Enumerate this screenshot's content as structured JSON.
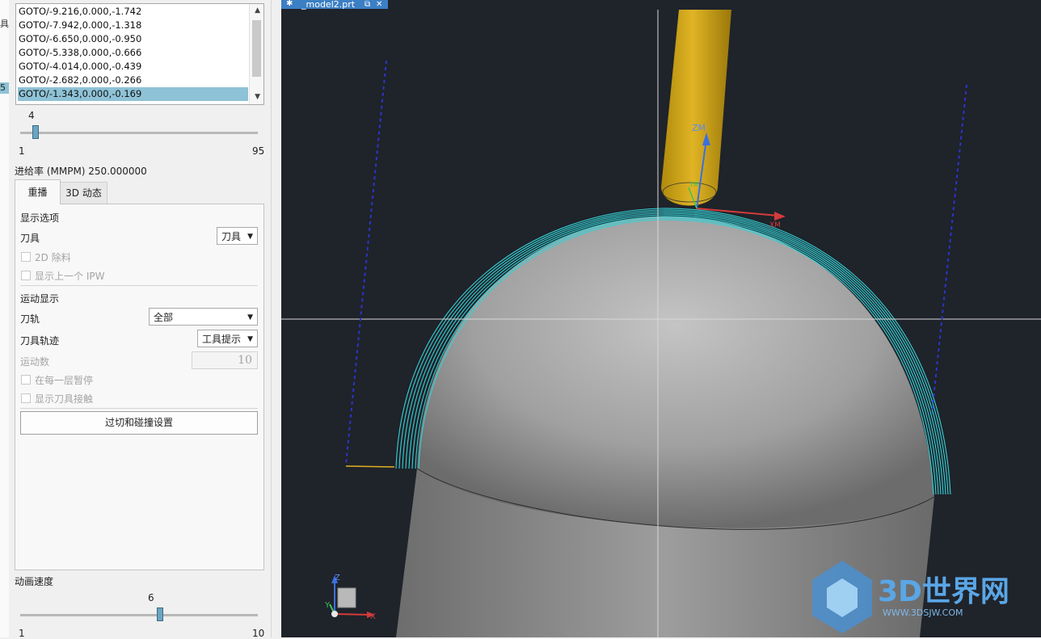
{
  "side_strip": {
    "char_top": "具",
    "char_sel": "5"
  },
  "toolpath_list": {
    "items": [
      "GOTO/-9.216,0.000,-1.742",
      "GOTO/-7.942,0.000,-1.318",
      "GOTO/-6.650,0.000,-0.950",
      "GOTO/-5.338,0.000,-0.666",
      "GOTO/-4.014,0.000,-0.439",
      "GOTO/-2.682,0.000,-0.266",
      "GOTO/-1.343,0.000,-0.169"
    ],
    "selected_index": 6
  },
  "position_slider": {
    "value": "4",
    "min": "1",
    "max": "95",
    "fraction": 0.032
  },
  "feed_rate": "进给率 (MMPM) 250.000000",
  "tabs": {
    "replay": "重播",
    "dynamic3d": "3D 动态"
  },
  "display_options": {
    "heading": "显示选项",
    "tool_label": "刀具",
    "tool_value": "刀具",
    "ipw2d": "2D 除料",
    "show_prev_ipw": "显示上一个 IPW"
  },
  "motion_display": {
    "heading": "运动显示",
    "toolpath_label": "刀轨",
    "toolpath_value": "全部",
    "tool_trace_label": "刀具轨迹",
    "tool_trace_value": "工具提示",
    "motion_count_label": "运动数",
    "motion_count_value": "10",
    "pause_each_layer": "在每一层暂停",
    "show_tool_contact": "显示刀具接触",
    "gouge_button": "过切和碰撞设置"
  },
  "anim_speed": {
    "label": "动画速度",
    "value": "6",
    "min": "1",
    "max": "10",
    "fraction": 0.556
  },
  "viewport": {
    "tab_title": "_model2.prt",
    "axis_zm": "ZM",
    "axis_ym": "YM",
    "axis_xm": "XM",
    "triad_z": "Z",
    "triad_y": "Y",
    "triad_x": "X",
    "watermark_title": "3D世界网",
    "watermark_url": "WWW.3DSJW.COM"
  },
  "colors": {
    "selection": "#8ec2d6",
    "toolpath": "#33d2d6",
    "tool": "#c6a019",
    "viewport_bg": "#1f232a"
  }
}
